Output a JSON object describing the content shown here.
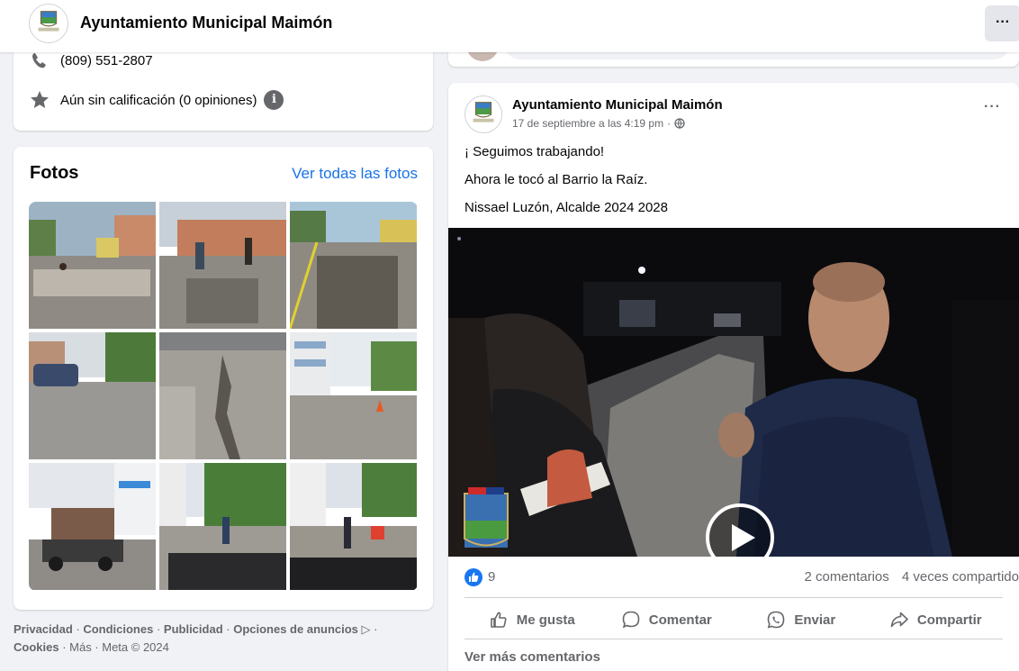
{
  "header": {
    "page_name": "Ayuntamiento Municipal Maimón",
    "more_label": "···"
  },
  "about": {
    "phone": "(809) 551-2807",
    "rating": "Aún sin calificación (0 opiniones)",
    "info_glyph": "i"
  },
  "photos": {
    "title": "Fotos",
    "see_all": "Ver todas las fotos",
    "count": 9
  },
  "footer": {
    "line1": [
      "Privacidad",
      "Condiciones",
      "Publicidad",
      "Opciones de anuncios"
    ],
    "line2_bold": "Cookies",
    "line2_rest": " · Más · Meta © 2024"
  },
  "post": {
    "author": "Ayuntamiento Municipal Maimón",
    "timestamp": "17 de septiembre a las 4:19 pm",
    "text_lines": [
      "¡ Seguimos trabajando!",
      "Ahora le tocó al Barrio la Raíz.",
      "Nissael Luzón, Alcalde 2024 2028"
    ],
    "more_label": "···",
    "likes": "9",
    "comments": "2 comentarios",
    "shares": "4 veces compartido",
    "actions": {
      "like": "Me gusta",
      "comment": "Comentar",
      "send": "Enviar",
      "share": "Compartir"
    },
    "see_more_comments": "Ver más comentarios"
  },
  "colors": {
    "link": "#1a73e8",
    "like_blue": "#1877f2",
    "secondary_text": "#65676b",
    "background": "#f0f2f5"
  },
  "icons": {
    "phone": "phone-icon",
    "rating": "star-icon",
    "info": "info-icon",
    "globe": "globe-icon",
    "play": "play-icon",
    "like": "thumbs-up-icon",
    "comment": "comment-icon",
    "send": "whatsapp-icon",
    "share": "share-icon"
  }
}
